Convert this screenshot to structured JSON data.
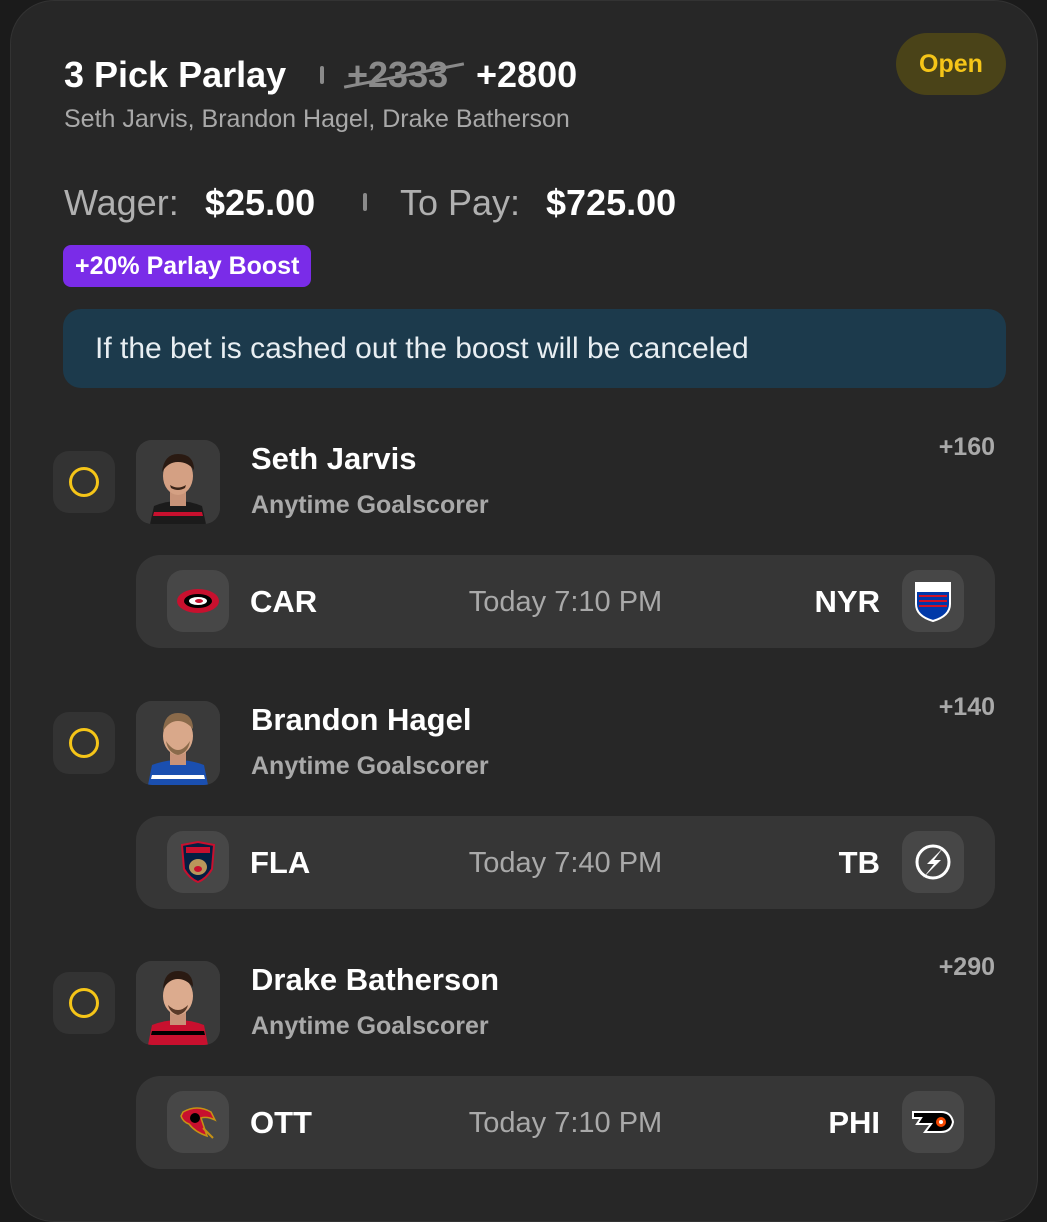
{
  "bet": {
    "title": "3 Pick Parlay",
    "old_odds": "+2333",
    "new_odds": "+2800",
    "players_summary": "Seth Jarvis, Brandon Hagel, Drake Batherson",
    "status": "Open"
  },
  "payout": {
    "wager_label": "Wager:",
    "wager_value": "$25.00",
    "topay_label": "To Pay:",
    "topay_value": "$725.00"
  },
  "boost": {
    "label": "+20% Parlay Boost"
  },
  "notice": {
    "text": "If the bet is cashed out the boost will be canceled"
  },
  "legs": [
    {
      "player": "Seth Jarvis",
      "market": "Anytime Goalscorer",
      "odds": "+160",
      "home": "CAR",
      "away": "NYR",
      "time": "Today 7:10 PM",
      "home_icon": "hurricanes-logo-icon",
      "away_icon": "rangers-logo-icon"
    },
    {
      "player": "Brandon Hagel",
      "market": "Anytime Goalscorer",
      "odds": "+140",
      "home": "FLA",
      "away": "TB",
      "time": "Today 7:40 PM",
      "home_icon": "panthers-logo-icon",
      "away_icon": "lightning-logo-icon"
    },
    {
      "player": "Drake Batherson",
      "market": "Anytime Goalscorer",
      "odds": "+290",
      "home": "OTT",
      "away": "PHI",
      "time": "Today 7:10 PM",
      "home_icon": "senators-logo-icon",
      "away_icon": "flyers-logo-icon"
    }
  ],
  "colors": {
    "accent_yellow": "#f5c518",
    "boost_purple": "#7a2ce8",
    "notice_bg": "#1c3a4c",
    "status_bg": "#4a4318"
  }
}
